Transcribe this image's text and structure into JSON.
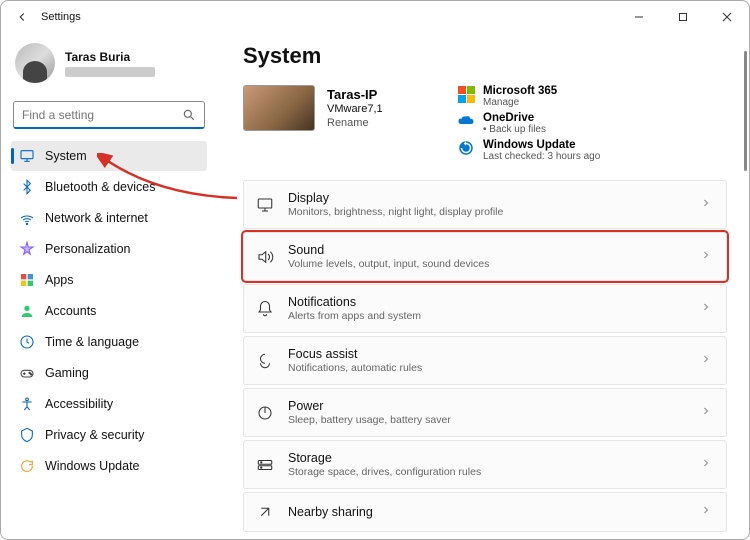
{
  "window": {
    "title": "Settings"
  },
  "user": {
    "name": "Taras Buria"
  },
  "search": {
    "placeholder": "Find a setting"
  },
  "nav": [
    {
      "key": "system",
      "label": "System",
      "selected": true
    },
    {
      "key": "bluetooth",
      "label": "Bluetooth & devices",
      "selected": false
    },
    {
      "key": "network",
      "label": "Network & internet",
      "selected": false
    },
    {
      "key": "personalization",
      "label": "Personalization",
      "selected": false
    },
    {
      "key": "apps",
      "label": "Apps",
      "selected": false
    },
    {
      "key": "accounts",
      "label": "Accounts",
      "selected": false
    },
    {
      "key": "time",
      "label": "Time & language",
      "selected": false
    },
    {
      "key": "gaming",
      "label": "Gaming",
      "selected": false
    },
    {
      "key": "accessibility",
      "label": "Accessibility",
      "selected": false
    },
    {
      "key": "privacy",
      "label": "Privacy & security",
      "selected": false
    },
    {
      "key": "update",
      "label": "Windows Update",
      "selected": false
    }
  ],
  "main": {
    "heading": "System",
    "pc": {
      "name": "Taras-IP",
      "model": "VMware7,1",
      "rename": "Rename"
    },
    "cards": {
      "ms365": {
        "title": "Microsoft 365",
        "sub": "Manage"
      },
      "onedrive": {
        "title": "OneDrive",
        "sub": "Back up files"
      },
      "update": {
        "title": "Windows Update",
        "sub": "Last checked: 3 hours ago"
      }
    },
    "rows": [
      {
        "key": "display",
        "title": "Display",
        "sub": "Monitors, brightness, night light, display profile",
        "highlighted": false
      },
      {
        "key": "sound",
        "title": "Sound",
        "sub": "Volume levels, output, input, sound devices",
        "highlighted": true
      },
      {
        "key": "notifications",
        "title": "Notifications",
        "sub": "Alerts from apps and system",
        "highlighted": false
      },
      {
        "key": "focus",
        "title": "Focus assist",
        "sub": "Notifications, automatic rules",
        "highlighted": false
      },
      {
        "key": "power",
        "title": "Power",
        "sub": "Sleep, battery usage, battery saver",
        "highlighted": false
      },
      {
        "key": "storage",
        "title": "Storage",
        "sub": "Storage space, drives, configuration rules",
        "highlighted": false
      },
      {
        "key": "nearby",
        "title": "Nearby sharing",
        "sub": "",
        "highlighted": false
      }
    ]
  }
}
